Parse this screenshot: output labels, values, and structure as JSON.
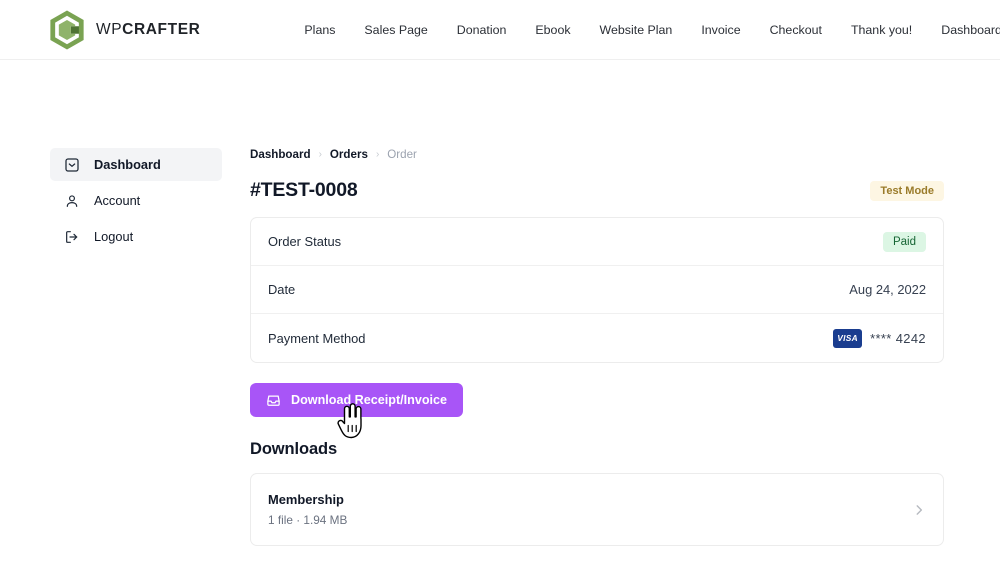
{
  "header": {
    "brand": {
      "part1": "WP",
      "part2": "CRAFTER",
      "logo_icon": "wpcrafter-hexagon-logo"
    },
    "nav": [
      {
        "label": "Plans"
      },
      {
        "label": "Sales Page"
      },
      {
        "label": "Donation"
      },
      {
        "label": "Ebook"
      },
      {
        "label": "Website Plan"
      },
      {
        "label": "Invoice"
      },
      {
        "label": "Checkout"
      },
      {
        "label": "Thank you!"
      },
      {
        "label": "Dashboard"
      }
    ]
  },
  "sidebar": {
    "items": [
      {
        "label": "Dashboard",
        "icon": "inbox-icon",
        "active": true
      },
      {
        "label": "Account",
        "icon": "user-icon",
        "active": false
      },
      {
        "label": "Logout",
        "icon": "logout-icon",
        "active": false
      }
    ]
  },
  "breadcrumb": {
    "items": [
      {
        "label": "Dashboard",
        "current": false
      },
      {
        "label": "Orders",
        "current": false
      },
      {
        "label": "Order",
        "current": true
      }
    ],
    "separator": "›"
  },
  "order": {
    "title": "#TEST-0008",
    "test_mode_badge": "Test Mode",
    "rows": [
      {
        "label": "Order Status",
        "value": "Paid",
        "type": "badge"
      },
      {
        "label": "Date",
        "value": "Aug 24, 2022",
        "type": "text"
      },
      {
        "label": "Payment Method",
        "value": "**** 4242",
        "type": "card",
        "brand": "VISA"
      }
    ]
  },
  "actions": {
    "download_label": "Download Receipt/Invoice",
    "download_icon": "inbox-download-icon",
    "cursor": "pointer-hand-cursor"
  },
  "downloads": {
    "section_title": "Downloads",
    "items": [
      {
        "name": "Membership",
        "meta": "1 file · 1.94 MB",
        "chevron": "chevron-right-icon"
      }
    ]
  },
  "colors": {
    "accent_purple": "#a855f7",
    "brand_green": "#6f9a4e",
    "badge_test_bg": "#fdf6e3",
    "badge_test_text": "#9a7b2a",
    "badge_paid_bg": "#dcf6e4",
    "badge_paid_text": "#166534",
    "visa_blue": "#1a3d8f"
  }
}
